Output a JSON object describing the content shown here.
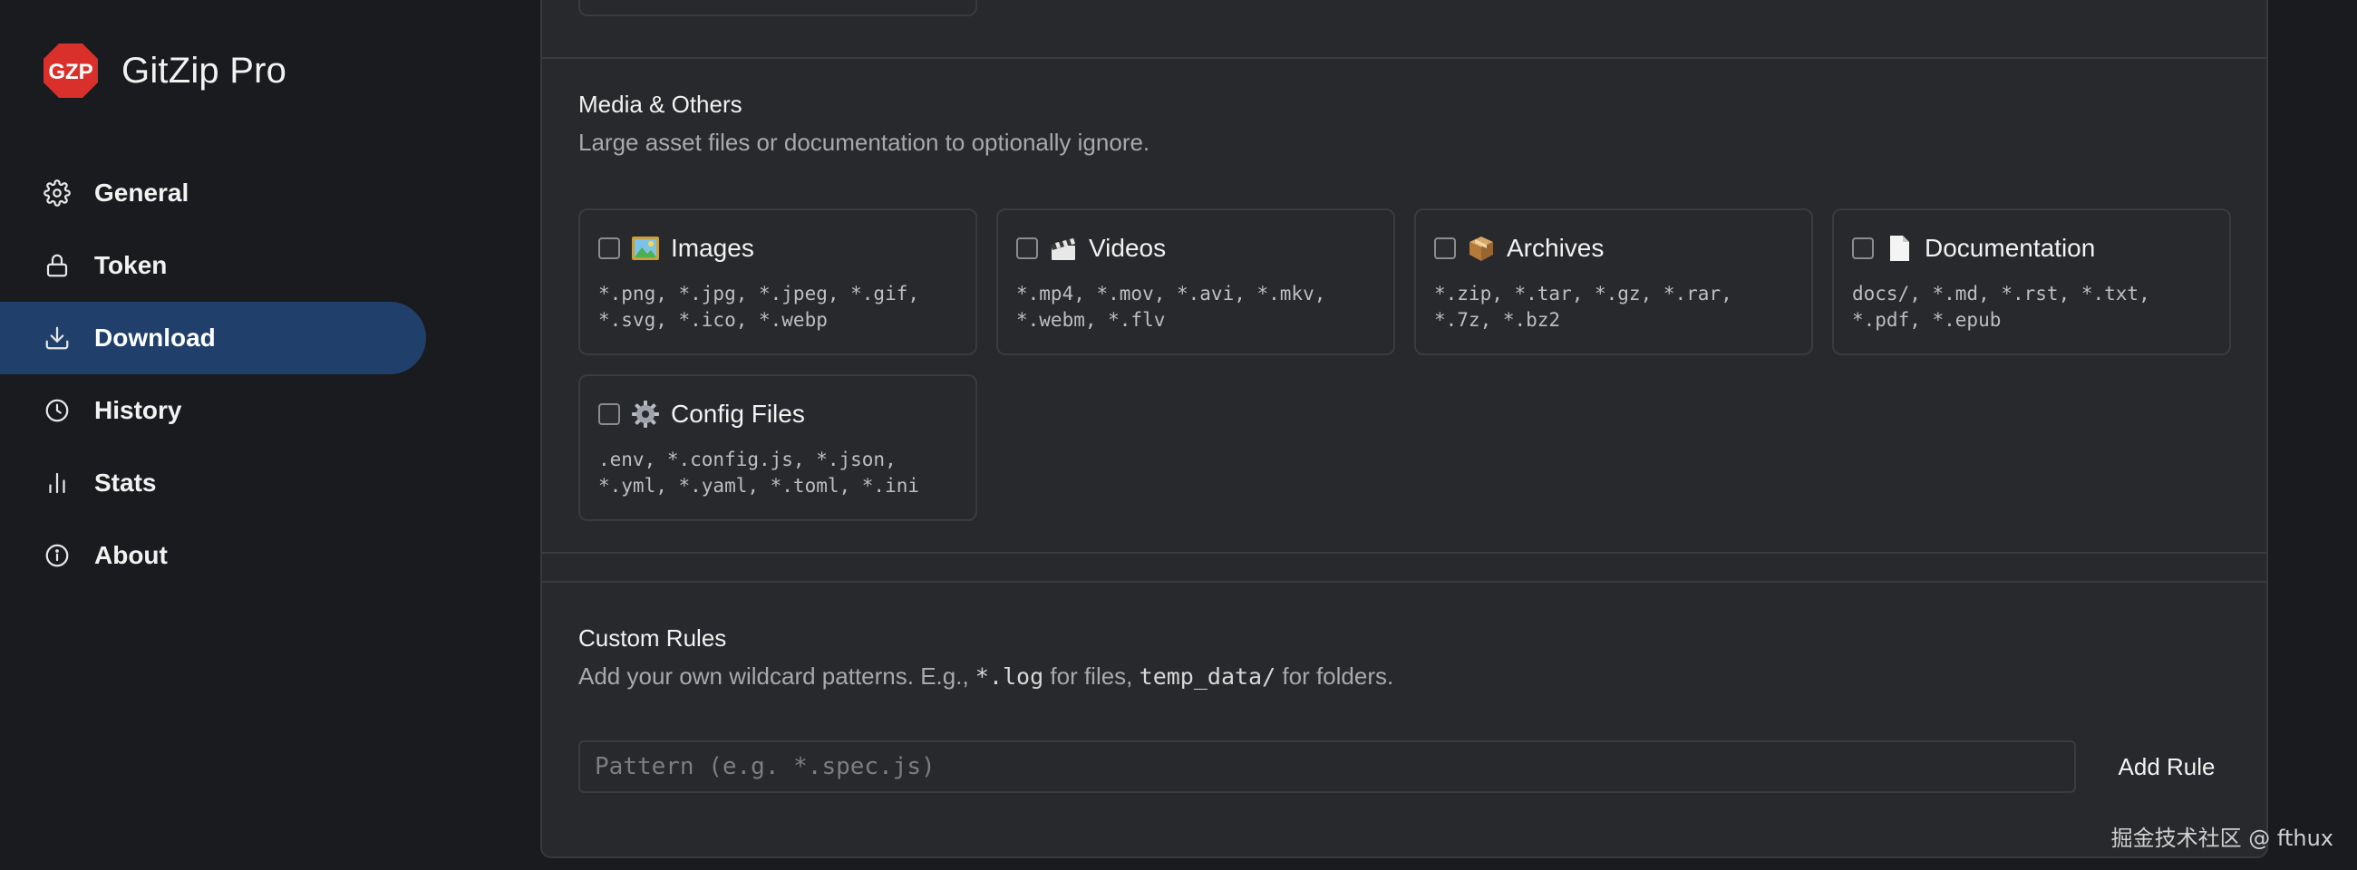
{
  "app": {
    "logo_text": "GZP",
    "name": "GitZip Pro",
    "logo_color": "#d9302c"
  },
  "sidebar": {
    "items": [
      {
        "label": "General",
        "icon": "gear-icon",
        "active": false
      },
      {
        "label": "Token",
        "icon": "lock-icon",
        "active": false
      },
      {
        "label": "Download",
        "icon": "download-icon",
        "active": true
      },
      {
        "label": "History",
        "icon": "clock-icon",
        "active": false
      },
      {
        "label": "Stats",
        "icon": "bar-chart-icon",
        "active": false
      },
      {
        "label": "About",
        "icon": "info-icon",
        "active": false
      }
    ],
    "active_color": "#20406b"
  },
  "media_section": {
    "title": "Media & Others",
    "description": "Large asset files or documentation to optionally ignore.",
    "cards": [
      {
        "title": "Images",
        "emoji": "framed-picture-icon",
        "checked": false,
        "patterns": "*.png, *.jpg, *.jpeg, *.gif, *.svg, *.ico, *.webp"
      },
      {
        "title": "Videos",
        "emoji": "clapper-board-icon",
        "checked": false,
        "patterns": "*.mp4, *.mov, *.avi, *.mkv, *.webm, *.flv"
      },
      {
        "title": "Archives",
        "emoji": "package-icon",
        "checked": false,
        "patterns": "*.zip, *.tar, *.gz, *.rar, *.7z, *.bz2"
      },
      {
        "title": "Documentation",
        "emoji": "page-facing-up-icon",
        "checked": false,
        "patterns": "docs/, *.md, *.rst, *.txt, *.pdf, *.epub"
      },
      {
        "title": "Config Files",
        "emoji": "gear-emoji-icon",
        "checked": false,
        "patterns": ".env, *.config.js, *.json, *.yml, *.yaml, *.toml, *.ini"
      }
    ]
  },
  "custom_rules": {
    "title": "Custom Rules",
    "desc_prefix": "Add your own wildcard patterns. E.g., ",
    "desc_code1": "*.log",
    "desc_mid": " for files, ",
    "desc_code2": "temp_data/",
    "desc_suffix": " for folders.",
    "input_placeholder": "Pattern (e.g. *.spec.js)",
    "input_value": "",
    "add_label": "Add Rule"
  },
  "watermark": "掘金技术社区 @ fthux"
}
